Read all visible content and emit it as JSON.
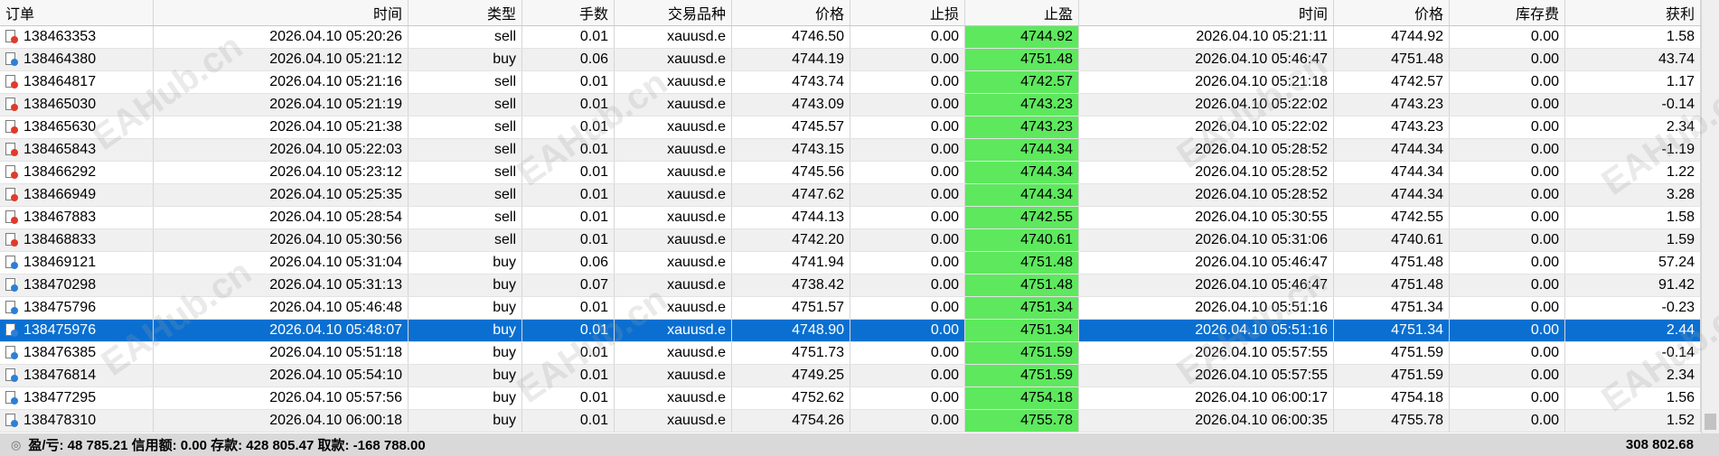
{
  "columns": [
    "订单",
    "时间",
    "类型",
    "手数",
    "交易品种",
    "价格",
    "止损",
    "止盈",
    "时间",
    "价格",
    "库存费",
    "获利"
  ],
  "rows": [
    {
      "order": "138463353",
      "open_time": "2026.04.10 05:20:26",
      "type": "sell",
      "volume": "0.01",
      "symbol": "xauusd.e",
      "open_price": "4746.50",
      "sl": "0.00",
      "tp": "4744.92",
      "close_time": "2026.04.10 05:21:11",
      "close_price": "4744.92",
      "swap": "0.00",
      "profit": "1.58"
    },
    {
      "order": "138464380",
      "open_time": "2026.04.10 05:21:12",
      "type": "buy",
      "volume": "0.06",
      "symbol": "xauusd.e",
      "open_price": "4744.19",
      "sl": "0.00",
      "tp": "4751.48",
      "close_time": "2026.04.10 05:46:47",
      "close_price": "4751.48",
      "swap": "0.00",
      "profit": "43.74"
    },
    {
      "order": "138464817",
      "open_time": "2026.04.10 05:21:16",
      "type": "sell",
      "volume": "0.01",
      "symbol": "xauusd.e",
      "open_price": "4743.74",
      "sl": "0.00",
      "tp": "4742.57",
      "close_time": "2026.04.10 05:21:18",
      "close_price": "4742.57",
      "swap": "0.00",
      "profit": "1.17"
    },
    {
      "order": "138465030",
      "open_time": "2026.04.10 05:21:19",
      "type": "sell",
      "volume": "0.01",
      "symbol": "xauusd.e",
      "open_price": "4743.09",
      "sl": "0.00",
      "tp": "4743.23",
      "close_time": "2026.04.10 05:22:02",
      "close_price": "4743.23",
      "swap": "0.00",
      "profit": "-0.14"
    },
    {
      "order": "138465630",
      "open_time": "2026.04.10 05:21:38",
      "type": "sell",
      "volume": "0.01",
      "symbol": "xauusd.e",
      "open_price": "4745.57",
      "sl": "0.00",
      "tp": "4743.23",
      "close_time": "2026.04.10 05:22:02",
      "close_price": "4743.23",
      "swap": "0.00",
      "profit": "2.34"
    },
    {
      "order": "138465843",
      "open_time": "2026.04.10 05:22:03",
      "type": "sell",
      "volume": "0.01",
      "symbol": "xauusd.e",
      "open_price": "4743.15",
      "sl": "0.00",
      "tp": "4744.34",
      "close_time": "2026.04.10 05:28:52",
      "close_price": "4744.34",
      "swap": "0.00",
      "profit": "-1.19"
    },
    {
      "order": "138466292",
      "open_time": "2026.04.10 05:23:12",
      "type": "sell",
      "volume": "0.01",
      "symbol": "xauusd.e",
      "open_price": "4745.56",
      "sl": "0.00",
      "tp": "4744.34",
      "close_time": "2026.04.10 05:28:52",
      "close_price": "4744.34",
      "swap": "0.00",
      "profit": "1.22"
    },
    {
      "order": "138466949",
      "open_time": "2026.04.10 05:25:35",
      "type": "sell",
      "volume": "0.01",
      "symbol": "xauusd.e",
      "open_price": "4747.62",
      "sl": "0.00",
      "tp": "4744.34",
      "close_time": "2026.04.10 05:28:52",
      "close_price": "4744.34",
      "swap": "0.00",
      "profit": "3.28"
    },
    {
      "order": "138467883",
      "open_time": "2026.04.10 05:28:54",
      "type": "sell",
      "volume": "0.01",
      "symbol": "xauusd.e",
      "open_price": "4744.13",
      "sl": "0.00",
      "tp": "4742.55",
      "close_time": "2026.04.10 05:30:55",
      "close_price": "4742.55",
      "swap": "0.00",
      "profit": "1.58"
    },
    {
      "order": "138468833",
      "open_time": "2026.04.10 05:30:56",
      "type": "sell",
      "volume": "0.01",
      "symbol": "xauusd.e",
      "open_price": "4742.20",
      "sl": "0.00",
      "tp": "4740.61",
      "close_time": "2026.04.10 05:31:06",
      "close_price": "4740.61",
      "swap": "0.00",
      "profit": "1.59"
    },
    {
      "order": "138469121",
      "open_time": "2026.04.10 05:31:04",
      "type": "buy",
      "volume": "0.06",
      "symbol": "xauusd.e",
      "open_price": "4741.94",
      "sl": "0.00",
      "tp": "4751.48",
      "close_time": "2026.04.10 05:46:47",
      "close_price": "4751.48",
      "swap": "0.00",
      "profit": "57.24"
    },
    {
      "order": "138470298",
      "open_time": "2026.04.10 05:31:13",
      "type": "buy",
      "volume": "0.07",
      "symbol": "xauusd.e",
      "open_price": "4738.42",
      "sl": "0.00",
      "tp": "4751.48",
      "close_time": "2026.04.10 05:46:47",
      "close_price": "4751.48",
      "swap": "0.00",
      "profit": "91.42"
    },
    {
      "order": "138475796",
      "open_time": "2026.04.10 05:46:48",
      "type": "buy",
      "volume": "0.01",
      "symbol": "xauusd.e",
      "open_price": "4751.57",
      "sl": "0.00",
      "tp": "4751.34",
      "close_time": "2026.04.10 05:51:16",
      "close_price": "4751.34",
      "swap": "0.00",
      "profit": "-0.23"
    },
    {
      "order": "138475976",
      "open_time": "2026.04.10 05:48:07",
      "type": "buy",
      "volume": "0.01",
      "symbol": "xauusd.e",
      "open_price": "4748.90",
      "sl": "0.00",
      "tp": "4751.34",
      "close_time": "2026.04.10 05:51:16",
      "close_price": "4751.34",
      "swap": "0.00",
      "profit": "2.44",
      "selected": true
    },
    {
      "order": "138476385",
      "open_time": "2026.04.10 05:51:18",
      "type": "buy",
      "volume": "0.01",
      "symbol": "xauusd.e",
      "open_price": "4751.73",
      "sl": "0.00",
      "tp": "4751.59",
      "close_time": "2026.04.10 05:57:55",
      "close_price": "4751.59",
      "swap": "0.00",
      "profit": "-0.14"
    },
    {
      "order": "138476814",
      "open_time": "2026.04.10 05:54:10",
      "type": "buy",
      "volume": "0.01",
      "symbol": "xauusd.e",
      "open_price": "4749.25",
      "sl": "0.00",
      "tp": "4751.59",
      "close_time": "2026.04.10 05:57:55",
      "close_price": "4751.59",
      "swap": "0.00",
      "profit": "2.34"
    },
    {
      "order": "138477295",
      "open_time": "2026.04.10 05:57:56",
      "type": "buy",
      "volume": "0.01",
      "symbol": "xauusd.e",
      "open_price": "4752.62",
      "sl": "0.00",
      "tp": "4754.18",
      "close_time": "2026.04.10 06:00:17",
      "close_price": "4754.18",
      "swap": "0.00",
      "profit": "1.56"
    },
    {
      "order": "138478310",
      "open_time": "2026.04.10 06:00:18",
      "type": "buy",
      "volume": "0.01",
      "symbol": "xauusd.e",
      "open_price": "4754.26",
      "sl": "0.00",
      "tp": "4755.78",
      "close_time": "2026.04.10 06:00:35",
      "close_price": "4755.78",
      "swap": "0.00",
      "profit": "1.52"
    }
  ],
  "status": {
    "summary": "盈/亏: 48 785.21  信用额: 0.00  存款: 428 805.47  取款: -168 788.00",
    "total_profit": "308 802.68"
  },
  "watermark": "EAHub.cn",
  "colors": {
    "tp_highlight": "#5ee85e",
    "selected_row": "#0a6fd0",
    "sell_icon": "#e03a2a",
    "buy_icon": "#2c7fd6"
  }
}
